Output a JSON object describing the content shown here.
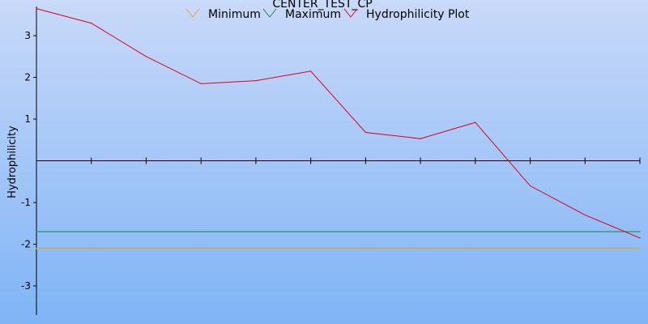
{
  "chart_data": {
    "type": "line",
    "title": "CENTER_TEST_CP",
    "xlabel": "",
    "ylabel": "Hydrophilicity",
    "ylim": [
      -3.7,
      3.7
    ],
    "xlim": [
      0,
      11
    ],
    "yticks": [
      "-3",
      "-2",
      "-1",
      "1",
      "2",
      "3"
    ],
    "x": [
      0,
      1,
      2,
      3,
      4,
      5,
      6,
      7,
      8,
      9,
      10,
      11
    ],
    "grid": false,
    "legend_position": "top",
    "background": [
      "#c9d9f9",
      "#7fb4f6"
    ],
    "series": [
      {
        "name": "Minimum",
        "color": "#f2a317",
        "values": [
          -2.1,
          -2.1,
          -2.1,
          -2.1,
          -2.1,
          -2.1,
          -2.1,
          -2.1,
          -2.1,
          -2.1,
          -2.1,
          -2.1
        ]
      },
      {
        "name": "Maximum",
        "color": "#0d8a3c",
        "values": [
          -1.7,
          -1.7,
          -1.7,
          -1.7,
          -1.7,
          -1.7,
          -1.7,
          -1.7,
          -1.7,
          -1.7,
          -1.7,
          -1.7
        ]
      },
      {
        "name": "Hydrophilicity Plot",
        "color": "#e0001a",
        "values": [
          3.65,
          3.3,
          2.5,
          1.85,
          1.92,
          2.15,
          0.68,
          0.53,
          0.92,
          -0.6,
          -1.3,
          -1.85
        ]
      }
    ]
  }
}
